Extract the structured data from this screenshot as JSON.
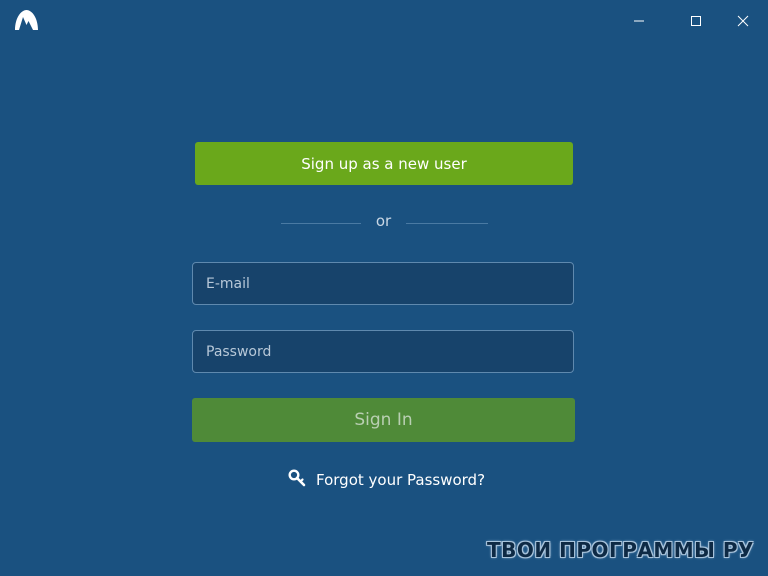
{
  "app": {
    "logo_icon": "mountain-logo-icon"
  },
  "window_controls": {
    "minimize_icon": "minimize-icon",
    "maximize_icon": "maximize-icon",
    "close_icon": "close-icon"
  },
  "signup": {
    "label": "Sign up as a new user"
  },
  "separator": {
    "label": "or"
  },
  "email": {
    "value": "",
    "placeholder": "E-mail"
  },
  "password": {
    "value": "",
    "placeholder": "Password"
  },
  "signin": {
    "label": "Sign In"
  },
  "forgot": {
    "icon": "key-icon",
    "label": "Forgot your Password?"
  },
  "watermark": {
    "text": "ТВОИ ПРОГРАММЫ РУ"
  },
  "colors": {
    "background": "#1a5180",
    "signup_button": "#6aa81b",
    "signin_button": "#4f8a38"
  }
}
